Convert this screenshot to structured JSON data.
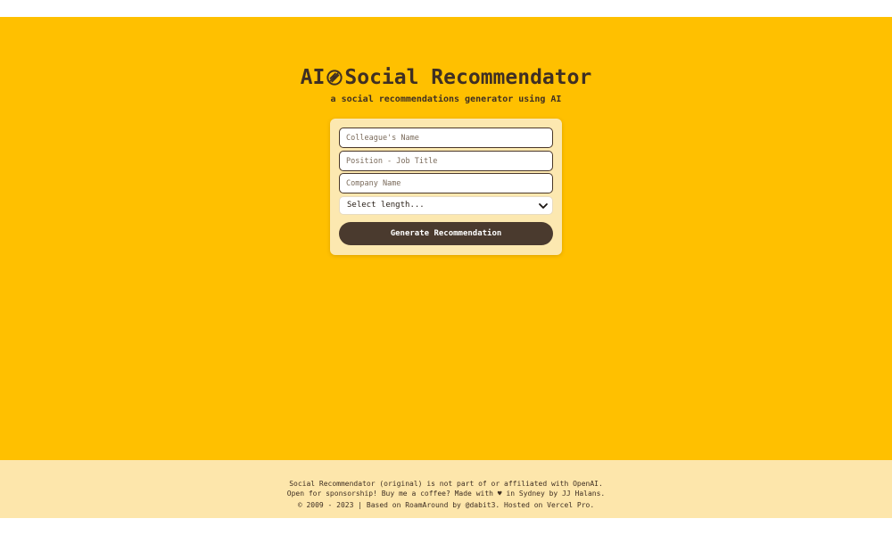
{
  "header": {
    "title_prefix": "AI",
    "logo_icon": "rocket-badge-icon",
    "title_main": "Social Recommendator",
    "subtitle": "a social recommendations generator using AI"
  },
  "form": {
    "colleague_name": {
      "placeholder": "Colleague's Name",
      "value": ""
    },
    "position": {
      "placeholder": "Position - Job Title",
      "value": ""
    },
    "company": {
      "placeholder": "Company Name",
      "value": ""
    },
    "length_select": {
      "selected": "Select length..."
    },
    "generate_label": "Generate Recommendation"
  },
  "footer": {
    "line1": "Social Recommendator (original) is not part of or affiliated with OpenAI.",
    "line2_prefix": "Open for sponsorship! Buy me a coffee? Made with",
    "heart": "♥",
    "line2_suffix": "in Sydney by JJ Halans.",
    "line3": "© 2009 - 2023 | Based on RoamAround by @dabit3. Hosted on Vercel Pro."
  },
  "colors": {
    "background": "#ffc000",
    "card": "#fce8b0",
    "button": "#4a3a2e",
    "text": "#3f2f23",
    "footer": "#fde6ab"
  }
}
